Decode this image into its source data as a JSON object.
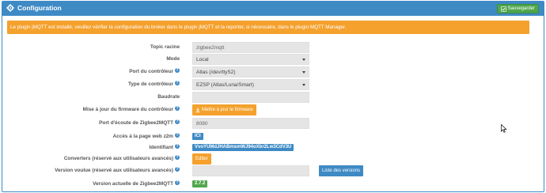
{
  "header": {
    "title": "Configuration",
    "icon": "gear-icon",
    "save_label": "Sauvegarder",
    "color": "#3e8ac5"
  },
  "alert": {
    "text": "Le plugin jMQTT est installé, veuillez vérifier la configuration du broker dans le plugin jMQTT et la reporter, si nécessaire, dans le plugin MQTT Manager.",
    "color": "#f4a12d"
  },
  "form": {
    "topic_racine": {
      "label": "Topic racine",
      "placeholder": "zigbee2mqtt"
    },
    "mode": {
      "label": "Mode",
      "value": "Local"
    },
    "port_controleur": {
      "label": "Port du contrôleur",
      "value": "Atlas (/dev/ttyS2)"
    },
    "type_controleur": {
      "label": "Type de contrôleur",
      "value": "EZSP (Atlas/Luna/Smart)"
    },
    "baudrate": {
      "label": "Baudrate",
      "value": ""
    },
    "firmware": {
      "label": "Mise à jour du firmware du contrôleur",
      "button": "Mettre à jour le firmware"
    },
    "port_ecoute": {
      "label": "Port d'écoute de Zigbee2MQTT",
      "placeholder": "8080"
    },
    "acces_page": {
      "label": "Accès à la page web z2m",
      "badge": "ICI"
    },
    "identifiant": {
      "label": "Identifiant",
      "badge": "VvoYUMdJHABmsmWJ94oXbr2Lw3CdV3U"
    },
    "converters": {
      "label": "Converters (réservé aux utilisateurs avancés)",
      "button": "Editer"
    },
    "version_voulue": {
      "label": "Version voulue (réservé aux utilisateurs avancés)",
      "value": "",
      "button": "Liste des versions"
    },
    "version_actuelle": {
      "label": "Version actuelle de Zigbee2MQTT",
      "badge": "2.7.2"
    }
  }
}
